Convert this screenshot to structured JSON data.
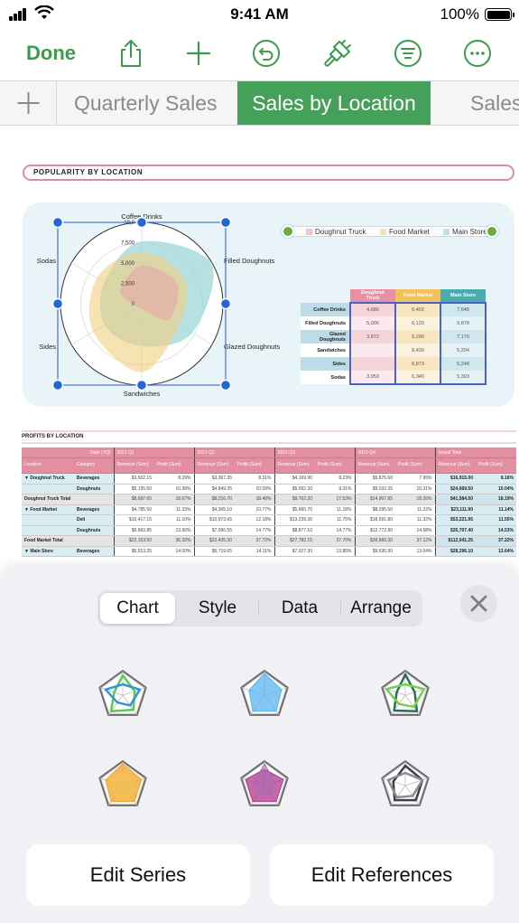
{
  "status_bar": {
    "time": "9:41 AM",
    "battery_percent": "100%"
  },
  "toolbar": {
    "done_label": "Done",
    "icons": [
      "share-icon",
      "add-icon",
      "undo-icon",
      "format-brush-icon",
      "filter-icon",
      "more-icon"
    ],
    "accent_color": "#3b9c4d"
  },
  "tabs": {
    "add_icon": "plus-icon",
    "items": [
      {
        "label": "Quarterly Sales",
        "active": false
      },
      {
        "label": "Sales by Location",
        "active": true
      },
      {
        "label": "Sales",
        "active": false
      }
    ]
  },
  "sheet": {
    "section_title": "POPULARITY BY LOCATION",
    "chart": {
      "legend": [
        "Doughnut Truck",
        "Food Market",
        "Main Store"
      ],
      "axis_ticks": [
        "0",
        "2,500",
        "5,000",
        "7,500",
        "10,0"
      ]
    },
    "popularity_table": {
      "headers": [
        "Doughnut Truck",
        "Food Market",
        "Main Store"
      ],
      "rows": [
        {
          "label": "Coffee Drinks",
          "values": [
            "4,686",
            "6,402",
            "7,648"
          ]
        },
        {
          "label": "Filled Doughnuts",
          "values": [
            "5,006",
            "6,120",
            "9,878"
          ]
        },
        {
          "label": "Glazed Doughnuts",
          "values": [
            "3,872",
            "5,290",
            "7,170"
          ]
        },
        {
          "label": "Sandwiches",
          "values": [
            "",
            "8,430",
            "5,204"
          ]
        },
        {
          "label": "Sides",
          "values": [
            "",
            "6,873",
            "5,248"
          ]
        },
        {
          "label": "Sodas",
          "values": [
            "3,053",
            "6,340",
            "5,303"
          ]
        }
      ]
    },
    "profits": {
      "title": "PROFITS BY LOCATION",
      "header_row1": [
        "Date (YQ)",
        "2021-Q1",
        "2021-Q2",
        "2021-Q3",
        "2021-Q4",
        "Grand Total"
      ],
      "header_row2": [
        "Location",
        "Category",
        "Revenue (Sum)",
        "Profit (Sum)",
        "Revenue (Sum)",
        "Profit (Sum)",
        "Revenue (Sum)",
        "Profit (Sum)",
        "Revenue (Sum)",
        "Profit (Sum)",
        "Revenue (Sum)",
        "Profit (Sum)"
      ],
      "rows": [
        {
          "location": "▼ Doughnut Truck",
          "category": "Beverages",
          "cells": [
            "$3,502.15",
            "8.29%",
            "$3,367.35",
            "8.31%",
            "$4,169.90",
            "8.23%",
            "$5,875.60",
            "7.95%",
            "$16,915.00",
            "8.16%"
          ],
          "total": false
        },
        {
          "location": "",
          "category": "Doughnuts",
          "cells": [
            "$5,195.50",
            "10.38%",
            "$4,849.35",
            "10.09%",
            "$5,592.30",
            "9.31%",
            "$9,032.35",
            "10.31%",
            "$24,669.50",
            "10.04%"
          ],
          "total": false
        },
        {
          "location": "Doughnut Truck Total",
          "category": "",
          "cells": [
            "$8,697.65",
            "18.67%",
            "$8,216.70",
            "18.40%",
            "$9,762.20",
            "17.53%",
            "$14,907.95",
            "18.26%",
            "$41,584.50",
            "18.19%"
          ],
          "total": true
        },
        {
          "location": "▼ Food Market",
          "category": "Beverages",
          "cells": [
            "$4,785.50",
            "11.33%",
            "$4,365.10",
            "10.77%",
            "$5,665.70",
            "11.18%",
            "$8,295.60",
            "11.22%",
            "$23,111.90",
            "11.14%"
          ],
          "total": false
        },
        {
          "location": "",
          "category": "Deli",
          "cells": [
            "$10,417.15",
            "11.10%",
            "$10,973.65",
            "12.18%",
            "$13,239.35",
            "11.75%",
            "$18,591.80",
            "11.32%",
            "$53,221.95",
            "11.55%"
          ],
          "total": false
        },
        {
          "location": "",
          "category": "Doughnuts",
          "cells": [
            "$6,960.85",
            "13.90%",
            "$7,096.55",
            "14.77%",
            "$8,877.10",
            "14.77%",
            "$12,772.90",
            "14.58%",
            "$35,707.40",
            "14.53%"
          ],
          "total": false
        },
        {
          "location": "Food Market Total",
          "category": "",
          "cells": [
            "$22,163.50",
            "36.32%",
            "$22,435.30",
            "37.72%",
            "$27,782.15",
            "37.70%",
            "$39,660.30",
            "37.12%",
            "$112,041.25",
            "37.22%"
          ],
          "total": true
        },
        {
          "location": "▼ Main Store",
          "category": "Beverages",
          "cells": [
            "$5,913.25",
            "14.00%",
            "$5,719.65",
            "14.11%",
            "$7,027.30",
            "13.86%",
            "$9,635.90",
            "13.04%",
            "$28,296.10",
            "13.64%"
          ],
          "total": false
        }
      ]
    }
  },
  "chart_data": {
    "type": "radar",
    "categories": [
      "Coffee Drinks",
      "Filled Doughnuts",
      "Glazed Doughnuts",
      "Sandwiches",
      "Sides",
      "Sodas"
    ],
    "series": [
      {
        "name": "Doughnut Truck",
        "color": "#e8a3a8",
        "values": [
          4686,
          5006,
          3872,
          0,
          0,
          3053
        ]
      },
      {
        "name": "Food Market",
        "color": "#f2cf7e",
        "values": [
          6402,
          6120,
          5290,
          8430,
          6873,
          6340
        ]
      },
      {
        "name": "Main Store",
        "color": "#9fd6da",
        "values": [
          7648,
          9878,
          7170,
          5204,
          5248,
          5303
        ]
      }
    ],
    "rlim": [
      0,
      10000
    ],
    "ticks": [
      0,
      2500,
      5000,
      7500,
      10000
    ],
    "legend_position": "top-right"
  },
  "bottom_panel": {
    "segments": [
      {
        "label": "Chart",
        "selected": true
      },
      {
        "label": "Style",
        "selected": false
      },
      {
        "label": "Data",
        "selected": false
      },
      {
        "label": "Arrange",
        "selected": false
      }
    ],
    "close_icon": "close-icon",
    "chart_styles": [
      {
        "name": "radar-style-green-blue-outline",
        "colors": [
          "#5ccb4a",
          "#3a8fe0"
        ]
      },
      {
        "name": "radar-style-blue-fill",
        "colors": [
          "#5ab4f0"
        ]
      },
      {
        "name": "radar-style-green-teal-outline",
        "colors": [
          "#2c6e5c",
          "#74d04f"
        ]
      },
      {
        "name": "radar-style-orange",
        "colors": [
          "#f0a425",
          "#f5c453"
        ]
      },
      {
        "name": "radar-style-purple-fill",
        "colors": [
          "#b2378f",
          "#a76bb3"
        ]
      },
      {
        "name": "radar-style-gray-outline",
        "colors": [
          "#3d4047",
          "#8a8d94"
        ]
      }
    ],
    "edit_series_label": "Edit Series",
    "edit_references_label": "Edit References"
  }
}
